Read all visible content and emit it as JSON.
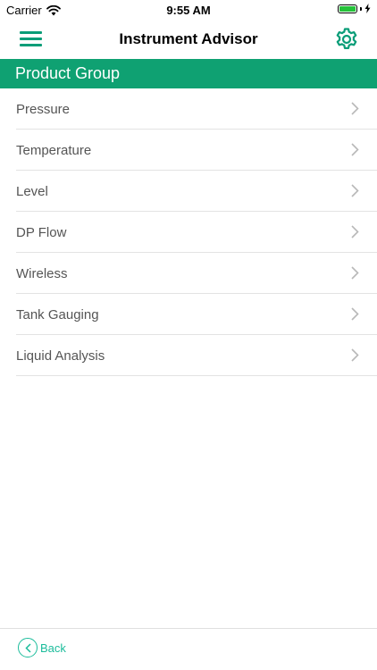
{
  "status_bar": {
    "carrier": "Carrier",
    "time": "9:55 AM"
  },
  "nav": {
    "title": "Instrument Advisor"
  },
  "section": {
    "title": "Product Group"
  },
  "product_groups": [
    {
      "label": "Pressure"
    },
    {
      "label": "Temperature"
    },
    {
      "label": "Level"
    },
    {
      "label": "DP Flow"
    },
    {
      "label": "Wireless"
    },
    {
      "label": "Tank Gauging"
    },
    {
      "label": "Liquid Analysis"
    }
  ],
  "footer": {
    "back_label": "Back"
  },
  "colors": {
    "brand_green": "#0fa172",
    "accent_teal": "#1bbc9b",
    "battery_green": "#25c23a"
  },
  "icons": {
    "menu": "hamburger-icon",
    "settings": "gear-icon",
    "row_chevron": "chevron-right-icon",
    "back": "chevron-left-icon"
  }
}
